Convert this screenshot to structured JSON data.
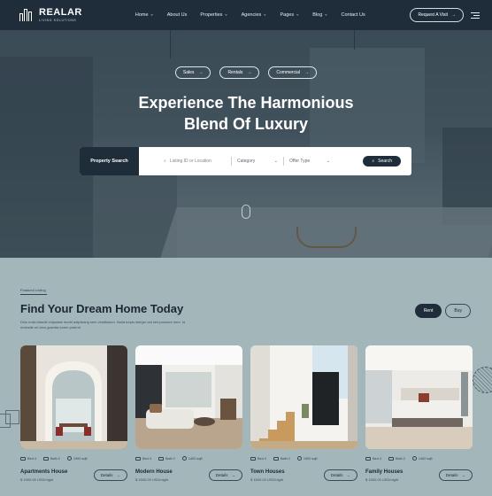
{
  "brand": {
    "name": "REALAR",
    "tagline": "LIVING SOLUTIONS"
  },
  "nav": {
    "items": [
      {
        "label": "Home",
        "dropdown": true
      },
      {
        "label": "About Us",
        "dropdown": false
      },
      {
        "label": "Properties",
        "dropdown": true
      },
      {
        "label": "Agencies",
        "dropdown": true
      },
      {
        "label": "Pages",
        "dropdown": true
      },
      {
        "label": "Blog",
        "dropdown": true
      },
      {
        "label": "Contact Us",
        "dropdown": false
      }
    ],
    "cta": "Request A Visit"
  },
  "hero": {
    "chips": [
      "Sales",
      "Rentals",
      "Commercial"
    ],
    "title_line1": "Experience The Harmonious",
    "title_line2": "Blend Of Luxury",
    "search": {
      "label": "Property Search",
      "placeholder": "Listing ID or Location",
      "category": "Category",
      "offer_type": "Offer Type",
      "button": "Search"
    }
  },
  "listing": {
    "eyebrow": "Featured Listing",
    "title": "Find Your Dream Home Today",
    "description": "Duis nulla blandit vulputate morbi adipiscing sem vestibulum. Nulla turpis integer dui sed posuere sem. Id molestie mi arcu gravida lorem potenti.",
    "tabs": [
      "Rent",
      "Buy"
    ],
    "active_tab": "Rent",
    "cards": [
      {
        "name": "Apartments House",
        "price": "$ 1900.00 USD/night",
        "bed": "Bed 4",
        "bath": "Bath 2",
        "area": "1900 sqft",
        "button": "Details"
      },
      {
        "name": "Modern House",
        "price": "$ 1500.00 USD/night",
        "bed": "Bed 4",
        "bath": "Bath 2",
        "area": "1400 sqft",
        "button": "Details"
      },
      {
        "name": "Town Houses",
        "price": "$ 1500.00 USD/night",
        "bed": "Bed 4",
        "bath": "Bath 2",
        "area": "1900 sqft",
        "button": "Details"
      },
      {
        "name": "Family Houses",
        "price": "$ 1500.00 USD/night",
        "bed": "Bed 4",
        "bath": "Bath 2",
        "area": "1400 sqft",
        "button": "Details"
      }
    ]
  },
  "colors": {
    "navy": "#1f2d3a",
    "section_bg": "#a3b6ba",
    "white": "#ffffff"
  }
}
